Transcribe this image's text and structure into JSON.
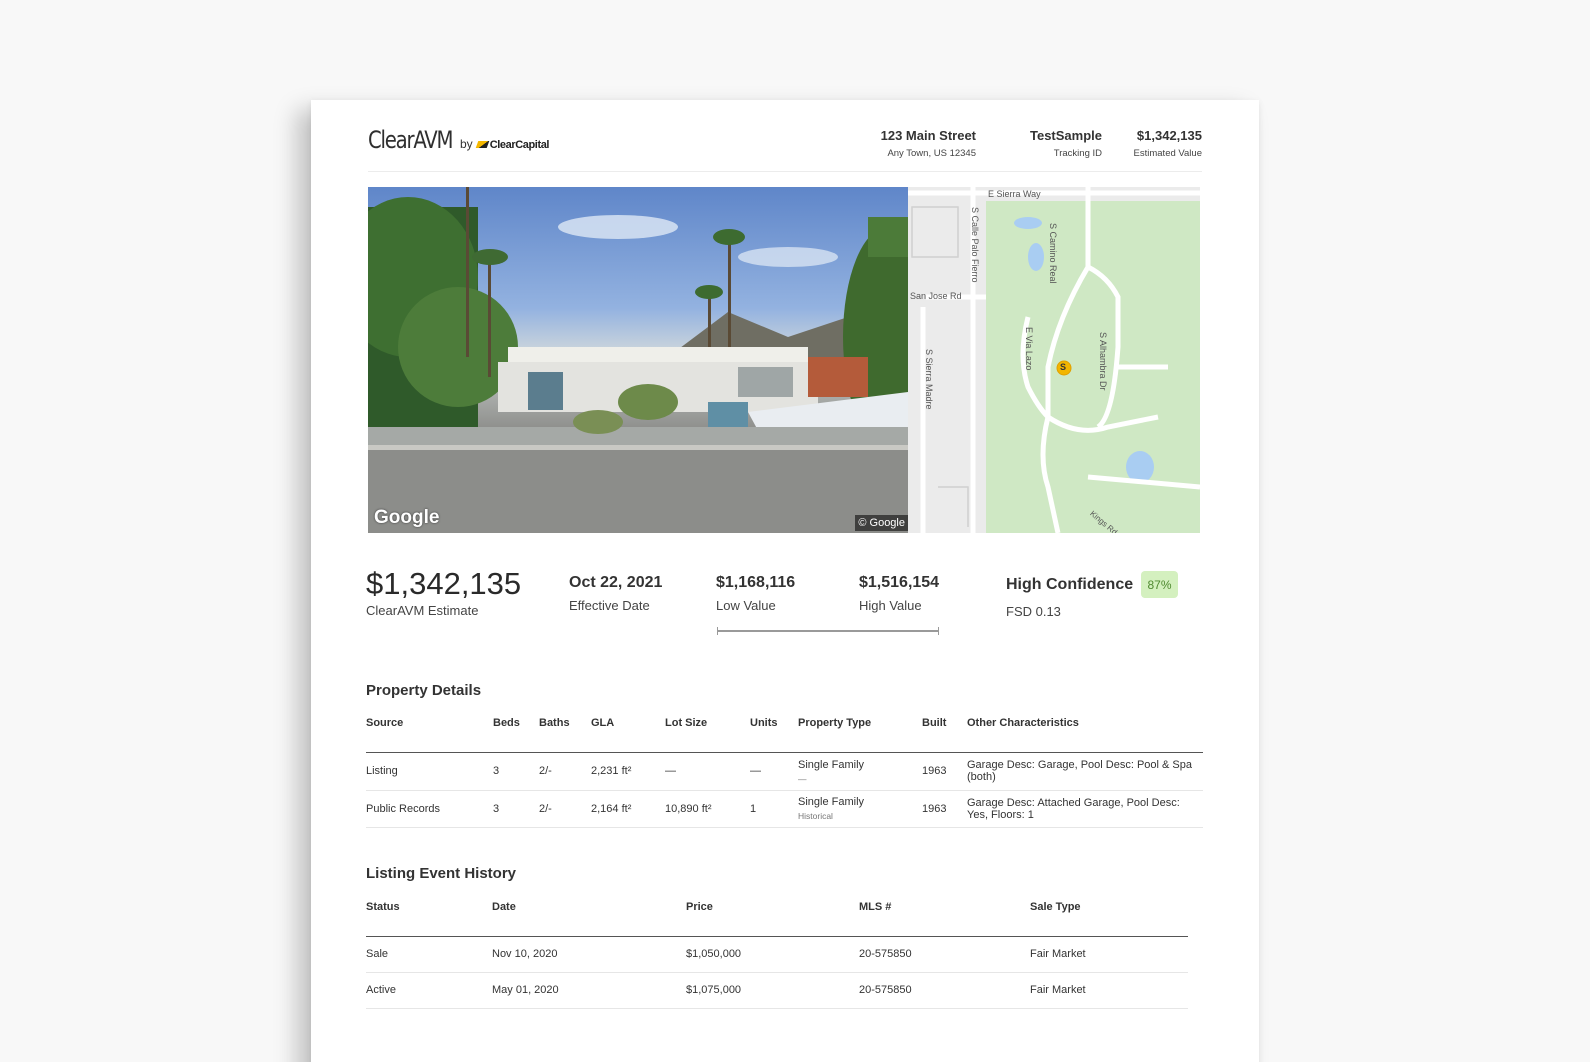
{
  "header": {
    "brand": "ClearAVM",
    "by": "by",
    "company": "ClearCapital",
    "address_line1": "123 Main Street",
    "address_line2": "Any Town, US 12345",
    "tracking_value": "TestSample",
    "tracking_label": "Tracking ID",
    "estimated_value": "$1,342,135",
    "estimated_label": "Estimated Value"
  },
  "images": {
    "streetview_watermark": "Google",
    "streetview_copyright": "© Google",
    "map_streets": [
      "E Sierra Way",
      "S Camino Real",
      "S Calle Palo Fierro",
      "San Jose Rd",
      "E Via Lazo",
      "S Alhambra Dr",
      "S Sierra Madre",
      "Kings Rd S"
    ],
    "map_marker": "S"
  },
  "summary": {
    "estimate": "$1,342,135",
    "estimate_label": "ClearAVM Estimate",
    "effective_date": "Oct 22, 2021",
    "effective_date_label": "Effective Date",
    "low_value": "$1,168,116",
    "low_label": "Low Value",
    "high_value": "$1,516,154",
    "high_label": "High Value",
    "confidence": "High Confidence",
    "confidence_pct": "87%",
    "fsd": "FSD 0.13"
  },
  "property_details": {
    "title": "Property Details",
    "columns": [
      "Source",
      "Beds",
      "Baths",
      "GLA",
      "Lot Size",
      "Units",
      "Property Type",
      "Built",
      "Other Characteristics"
    ],
    "rows": [
      {
        "source": "Listing",
        "beds": "3",
        "baths": "2/-",
        "gla": "2,231 ft²",
        "lot": "—",
        "units": "—",
        "type": "Single Family",
        "type_note": "—",
        "built": "1963",
        "other": "Garage Desc: Garage, Pool Desc: Pool & Spa (both)"
      },
      {
        "source": "Public Records",
        "beds": "3",
        "baths": "2/-",
        "gla": "2,164 ft²",
        "lot": "10,890 ft²",
        "units": "1",
        "type": "Single Family",
        "type_note": "Historical",
        "built": "1963",
        "other": "Garage Desc: Attached Garage, Pool Desc: Yes, Floors: 1"
      }
    ]
  },
  "listing_history": {
    "title": "Listing Event History",
    "columns": [
      "Status",
      "Date",
      "Price",
      "MLS #",
      "Sale Type"
    ],
    "rows": [
      {
        "status": "Sale",
        "date": "Nov 10, 2020",
        "price": "$1,050,000",
        "mls": "20-575850",
        "sale_type": "Fair Market"
      },
      {
        "status": "Active",
        "date": "May 01, 2020",
        "price": "$1,075,000",
        "mls": "20-575850",
        "sale_type": "Fair Market"
      }
    ]
  }
}
